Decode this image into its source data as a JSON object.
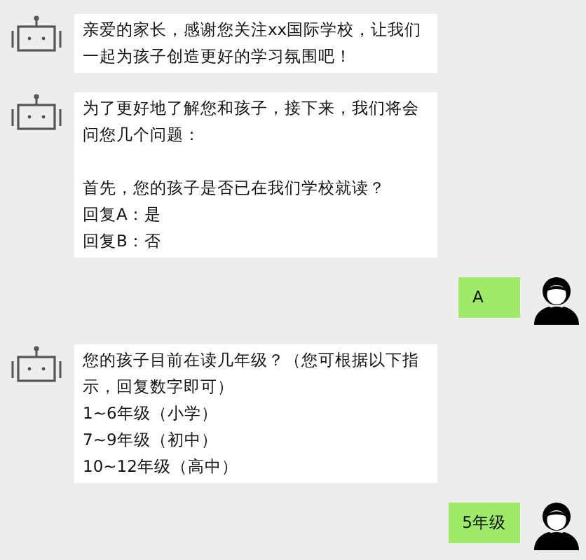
{
  "messages": [
    {
      "kind": "bot",
      "paragraphs": [
        [
          "亲爱的家长，感谢您关注xx国际学校，让我们一起为孩子创造更好的学习氛围吧！"
        ]
      ]
    },
    {
      "kind": "bot",
      "paragraphs": [
        [
          "为了更好地了解您和孩子，接下来，我们将会问您几个问题："
        ],
        [
          "首先，您的孩子是否已在我们学校就读？",
          "回复A：是",
          "回复B：否"
        ]
      ]
    },
    {
      "kind": "user",
      "paragraphs": [
        [
          "A"
        ]
      ]
    },
    {
      "kind": "bot",
      "paragraphs": [
        [
          "您的孩子目前在读几年级？（您可根据以下指示，回复数字即可）",
          "1~6年级（小学）",
          "7~9年级（初中）",
          "10~12年级（高中）"
        ]
      ]
    },
    {
      "kind": "user",
      "paragraphs": [
        [
          "5年级"
        ]
      ]
    }
  ]
}
